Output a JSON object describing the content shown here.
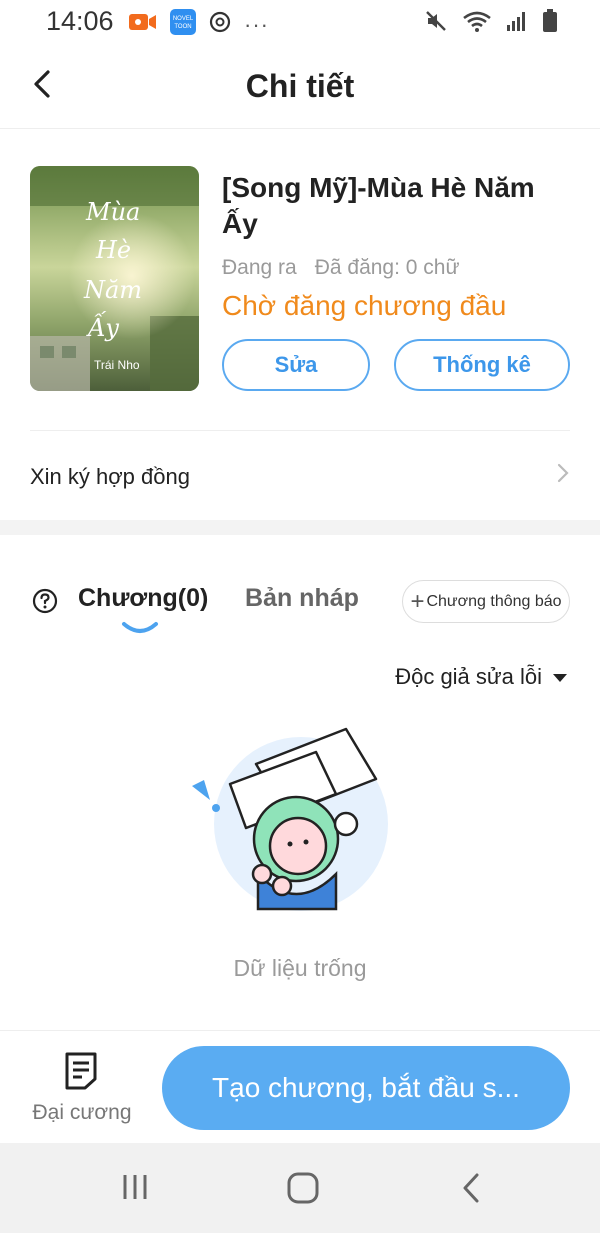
{
  "status_bar": {
    "time": "14:06",
    "left_icons": [
      "video-camera-icon",
      "noveltoon-app-icon",
      "threads-icon",
      "more-dots-icon"
    ],
    "novel_badge_top": "NOVEL",
    "novel_badge_bottom": "TOON",
    "more_text": "···",
    "right_icons": [
      "mute-icon",
      "wifi-icon",
      "signal-icon",
      "battery-icon"
    ]
  },
  "header": {
    "title": "Chi tiết",
    "back_icon": "chevron-left-icon"
  },
  "book": {
    "cover_title_lines": [
      "Mùa",
      "Hè",
      "Năm",
      "Ấy"
    ],
    "cover_author": "Trái Nho",
    "title": "[Song Mỹ]-Mùa Hè Năm Ấy",
    "status": "Đang ra",
    "published": "Đã đăng: 0 chữ",
    "pending_status": "Chờ đăng chương đầu",
    "edit_label": "Sửa",
    "stats_label": "Thống kê"
  },
  "contract": {
    "label": "Xin ký hợp đồng"
  },
  "tabs": {
    "help_icon": "question-circle-icon",
    "chapters_label": "Chương(0)",
    "drafts_label": "Bản nháp",
    "notice_label": "Chương thông báo",
    "notice_plus": "+"
  },
  "filter": {
    "label": "Độc giả sửa lỗi",
    "icon": "caret-down-icon"
  },
  "empty": {
    "text": "Dữ liệu trống"
  },
  "bottom": {
    "outline_label": "Đại cương",
    "create_label": "Tạo chương, bắt đầu s..."
  },
  "colors": {
    "accent_blue": "#5aacf2",
    "pending_orange": "#f08a1c"
  }
}
